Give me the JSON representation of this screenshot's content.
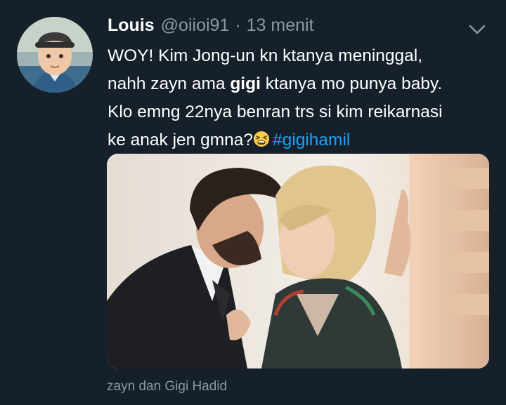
{
  "tweet": {
    "author_name": "Louis",
    "handle": "@oiioi91",
    "separator": "·",
    "time": "13 menit",
    "text_line1": "WOY! Kim Jong-un kn ktanya meninggal,",
    "text_line2_a": "nahh zayn ama ",
    "text_line2_bold": "gigi",
    "text_line2_b": " ktanya mo punya baby.",
    "text_line3": "Klo emng 22nya benran trs si kim reikarnasi",
    "text_line4": "ke anak jen gmna?",
    "emoji": "tired-face-emoji",
    "hashtag": "#gigihamil"
  },
  "media": {
    "caption": "zayn dan Gigi Hadid"
  },
  "icons": {
    "more": "chevron-down-icon"
  },
  "colors": {
    "background": "#15202b",
    "secondary_text": "#8899a6",
    "hashtag": "#1da1f2"
  }
}
